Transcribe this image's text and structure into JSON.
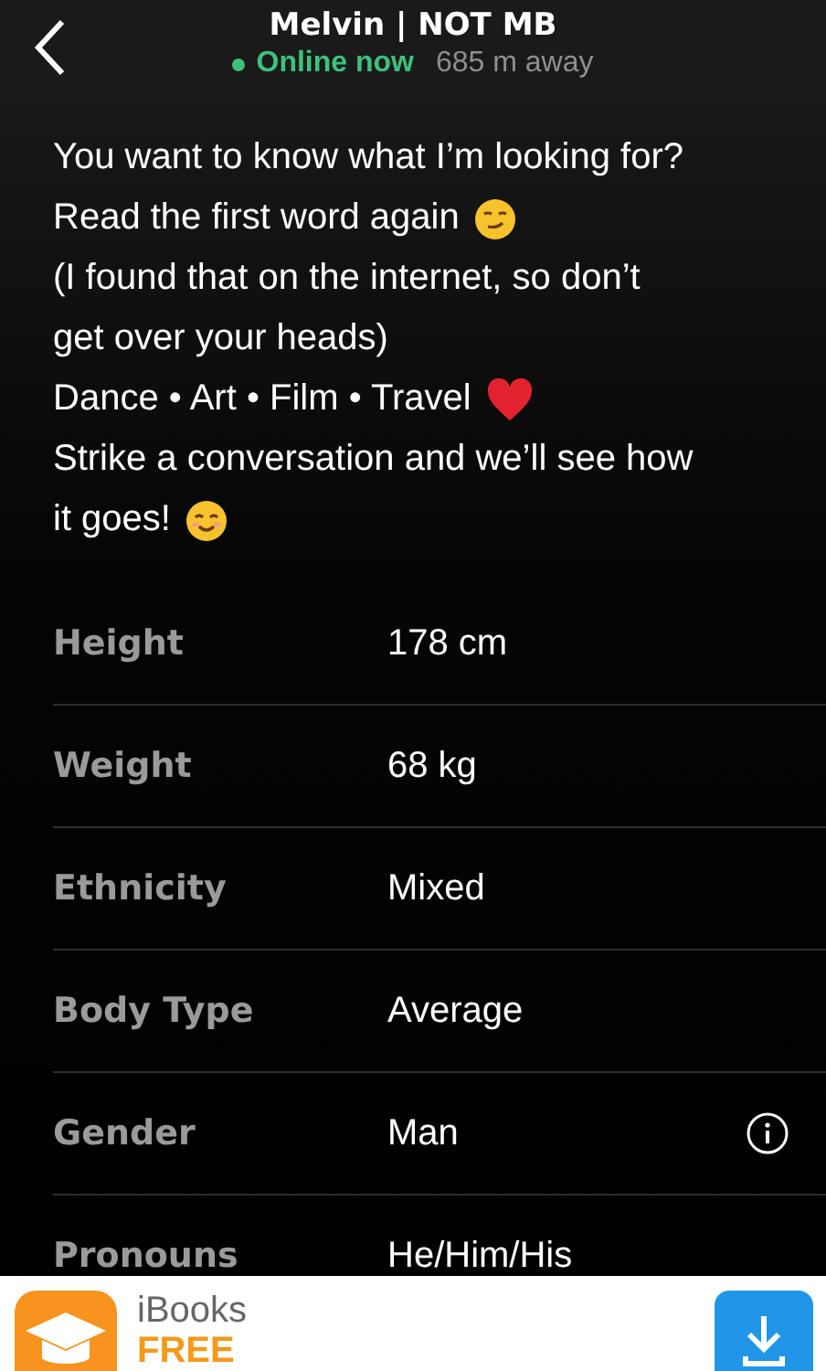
{
  "header": {
    "title": "Melvin | NOT MB",
    "online": true,
    "status": "Online now",
    "distance": "685 m away"
  },
  "bio": [
    {
      "text": "You want to know what I’m looking for?"
    },
    {
      "text": "Read the first word again",
      "kind": "smirk"
    },
    {
      "text": "(I found that on the internet, so don’t"
    },
    {
      "text": "get over your heads)"
    },
    {
      "text": "Dance • Art • Film • Travel",
      "kind": "heart"
    },
    {
      "text": "Strike a conversation and we’ll see how"
    },
    {
      "text": "it goes!",
      "kind": "smile"
    }
  ],
  "details": [
    {
      "label": "Height",
      "value": "178 cm"
    },
    {
      "label": "Weight",
      "value": "68 kg"
    },
    {
      "label": "Ethnicity",
      "value": "Mixed"
    },
    {
      "label": "Body Type",
      "value": "Average"
    },
    {
      "label": "Gender",
      "value": "Man",
      "info": true
    },
    {
      "label": "Pronouns",
      "value": "He/Him/His"
    }
  ],
  "ad": {
    "app": "iBooks",
    "price": "FREE"
  }
}
